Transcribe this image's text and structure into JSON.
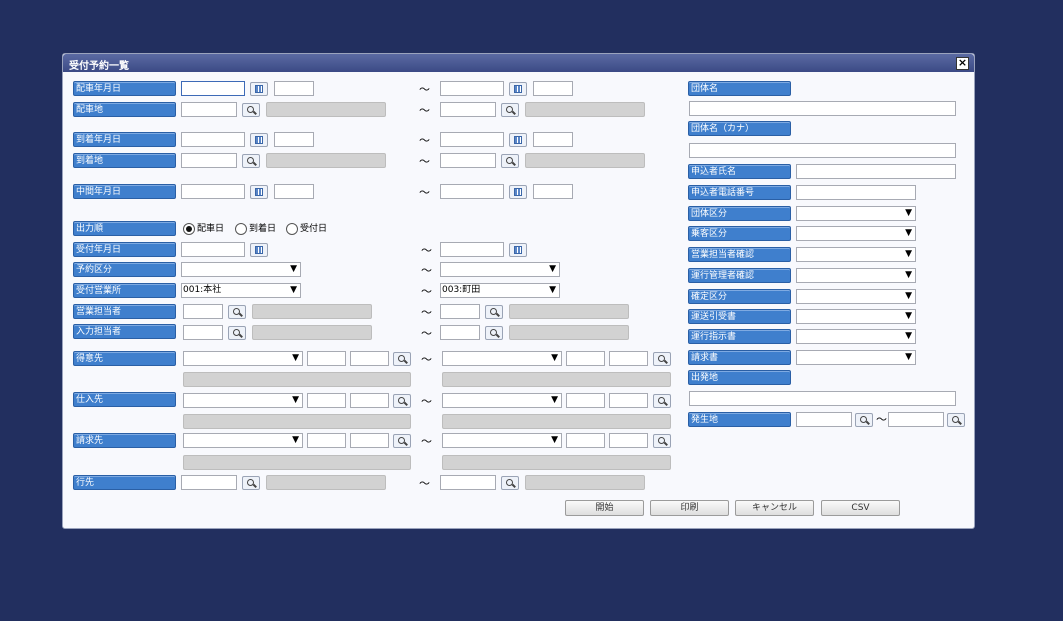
{
  "window": {
    "title": "受付予約一覧",
    "close_label": "×"
  },
  "tilde": "～",
  "labels": {
    "haisha_date": "配車年月日",
    "haisha_place": "配車地",
    "arrival_date": "到着年月日",
    "arrival_place": "到着地",
    "middle_date": "中間年月日",
    "output_order": "出力順",
    "reception_date": "受付年月日",
    "reservation_type": "予約区分",
    "reception_office": "受付営業所",
    "sales_staff": "営業担当者",
    "input_staff": "入力担当者",
    "customer": "得意先",
    "supplier": "仕入先",
    "billing": "請求先",
    "destination": "行先",
    "group_name": "団体名",
    "group_name_kana": "団体名（カナ）",
    "applicant_name": "申込者氏名",
    "applicant_phone": "申込者電話番号",
    "group_type": "団体区分",
    "passenger_type": "乗客区分",
    "sales_check": "営業担当者確認",
    "travel_mgr_check": "運行管理者確認",
    "confirm_type": "確定区分",
    "transfer_doc": "運送引受書",
    "instruction_doc": "運行指示書",
    "invoice": "請求書",
    "departure": "出発地",
    "origin": "発生地"
  },
  "radio_options": [
    "配車日",
    "到着日",
    "受付日"
  ],
  "radio_selected": 0,
  "office_from": "001:本社",
  "office_to": "003:町田",
  "buttons": {
    "start": "開始",
    "print": "印刷",
    "cancel": "キャンセル",
    "csv": "CSV"
  },
  "dropdown_arrow": "▼"
}
